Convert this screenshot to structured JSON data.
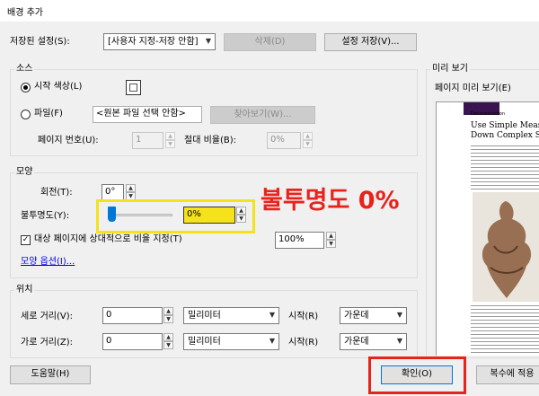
{
  "window": {
    "title": "배경 추가"
  },
  "saved_settings": {
    "label": "저장된 설정(S):",
    "value": "[사용자 지정-저장 안함]",
    "delete_label": "삭제(D)",
    "save_label": "설정 저장(V)..."
  },
  "source": {
    "group_label": "소스",
    "start_color_label": "시작 색상(L)",
    "file_label": "파일(F)",
    "file_value": "<원본 파일 선택 안함>",
    "browse_label": "찾아보기(W)...",
    "page_number_label": "페이지 번호(U):",
    "page_number_value": "1",
    "absolute_scale_label": "절대 비율(B):",
    "absolute_scale_value": "0%"
  },
  "appearance": {
    "group_label": "모양",
    "rotation_label": "회전(T):",
    "rotation_value": "0°",
    "opacity_label": "불투명도(Y):",
    "opacity_value": "0%",
    "opacity_level": 0,
    "relative_scale_label": "대상 페이지에 상대적으로 비율 지정(T)",
    "relative_scale_checked": true,
    "relative_scale_value": "100%",
    "options_link": "모양 옵션(I)..."
  },
  "position": {
    "group_label": "위치",
    "vertical_label": "세로 거리(V):",
    "vertical_value": "0",
    "vertical_unit": "밀리미터",
    "vertical_from_label": "시작(R)",
    "vertical_from_value": "가운데",
    "horizontal_label": "가로 거리(Z):",
    "horizontal_value": "0",
    "horizontal_unit": "밀리미터",
    "horizontal_from_label": "시작(R)",
    "horizontal_from_value": "가운데"
  },
  "preview": {
    "group_label": "미리 보기",
    "page_preview_label": "페이지 미리 보기(E)",
    "doc_kicker": "Deconstruction",
    "doc_title_line1": "Use Simple Measu",
    "doc_title_line2": "Down Complex Su"
  },
  "buttons": {
    "help_label": "도움말(H)",
    "ok_label": "확인(O)",
    "apply_multiple_label": "복수에 적용"
  },
  "annotation": {
    "text": "불투명도 0%",
    "color": "#e8231c",
    "highlight_color": "#f5e21a"
  }
}
